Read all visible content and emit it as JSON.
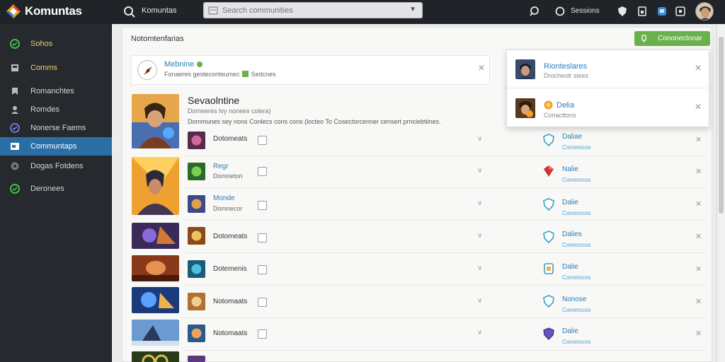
{
  "app": {
    "brand": "Komuntas"
  },
  "topbar": {
    "label": "Komuntas",
    "search_placeholder": "Search communities",
    "right_label": "Sessions"
  },
  "sidebar": {
    "items": [
      {
        "label": "Sohos"
      },
      {
        "label": "Comms"
      },
      {
        "label": "Romanchtes"
      },
      {
        "label": "Romdes"
      },
      {
        "label": "Nonerse Faems"
      },
      {
        "label": "Communtaps"
      },
      {
        "label": "Dogas Fotdens"
      },
      {
        "label": "Deronees"
      }
    ]
  },
  "panel": {
    "title": "Notomtenfarias",
    "connect_label": "Cononectonar"
  },
  "notice": {
    "title": "Mebnine",
    "subtitle": "Fonaeres gesteconteumec",
    "subtitle_tail": "Sedcnes"
  },
  "dropdown": {
    "items": [
      {
        "title": "Rionteslares",
        "sub": "Drocheutr siees"
      },
      {
        "title": "Delia",
        "sub": "Conacttons"
      }
    ]
  },
  "featured": {
    "title": "Sevaolntine",
    "subtitle": "Domeeres Ivy nonees colera)",
    "description": "Dommunes sey nons Conlecs cons cons (locteo To Cosectorcenner censert prnciebtiines."
  },
  "rows": [
    {
      "label": "Dotomeats",
      "blue": false,
      "sub": "",
      "name": "Daliae",
      "status": "Cononocos"
    },
    {
      "label": "Regr",
      "blue": true,
      "sub": "Domneton",
      "name": "Nalie",
      "status": "Cononocos"
    },
    {
      "label": "Monde",
      "blue": true,
      "sub": "Domnecor",
      "name": "Dalie",
      "status": "Cononocos"
    },
    {
      "label": "Dotomeats",
      "blue": false,
      "sub": "",
      "name": "Dalies",
      "status": "Cononocos"
    },
    {
      "label": "Dotemenis",
      "blue": false,
      "sub": "",
      "name": "Dalie",
      "status": "Cononocos"
    },
    {
      "label": "Notomaats",
      "blue": false,
      "sub": "",
      "name": "Nonose",
      "status": "Cononocos"
    },
    {
      "label": "Notomaats",
      "blue": false,
      "sub": "",
      "name": "Dalie",
      "status": "Cononocos"
    },
    {
      "label": "",
      "blue": false,
      "sub": "",
      "name": "",
      "status": ""
    }
  ],
  "colors": {
    "accent_green": "#6ab04c",
    "link_blue": "#2a7fb8",
    "sidebar_active": "#2b6ea6",
    "topbar_bg": "#202327"
  }
}
